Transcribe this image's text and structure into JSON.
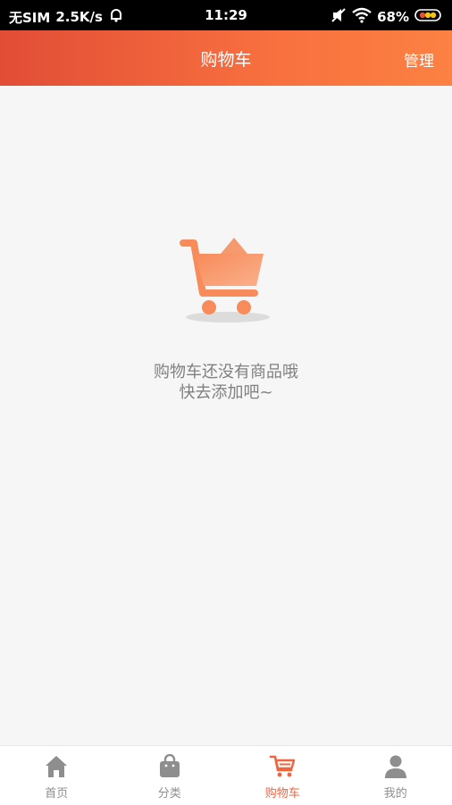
{
  "status_bar": {
    "carrier": "无SIM",
    "speed": "2.5K/s",
    "time": "11:29",
    "battery": "68%"
  },
  "header": {
    "title": "购物车",
    "manage_label": "管理"
  },
  "empty_state": {
    "line1": "购物车还没有商品哦",
    "line2": "快去添加吧~",
    "icon": "shopping-cart-icon"
  },
  "bottom_nav": {
    "items": [
      {
        "label": "首页",
        "icon": "home-icon",
        "active": false
      },
      {
        "label": "分类",
        "icon": "bag-icon",
        "active": false
      },
      {
        "label": "购物车",
        "icon": "cart-icon",
        "active": true
      },
      {
        "label": "我的",
        "icon": "user-icon",
        "active": false
      }
    ]
  },
  "colors": {
    "accent": "#f0653e",
    "header_gradient_start": "#e14d36",
    "header_gradient_end": "#fc8142",
    "nav_inactive": "#8e8e8e"
  }
}
